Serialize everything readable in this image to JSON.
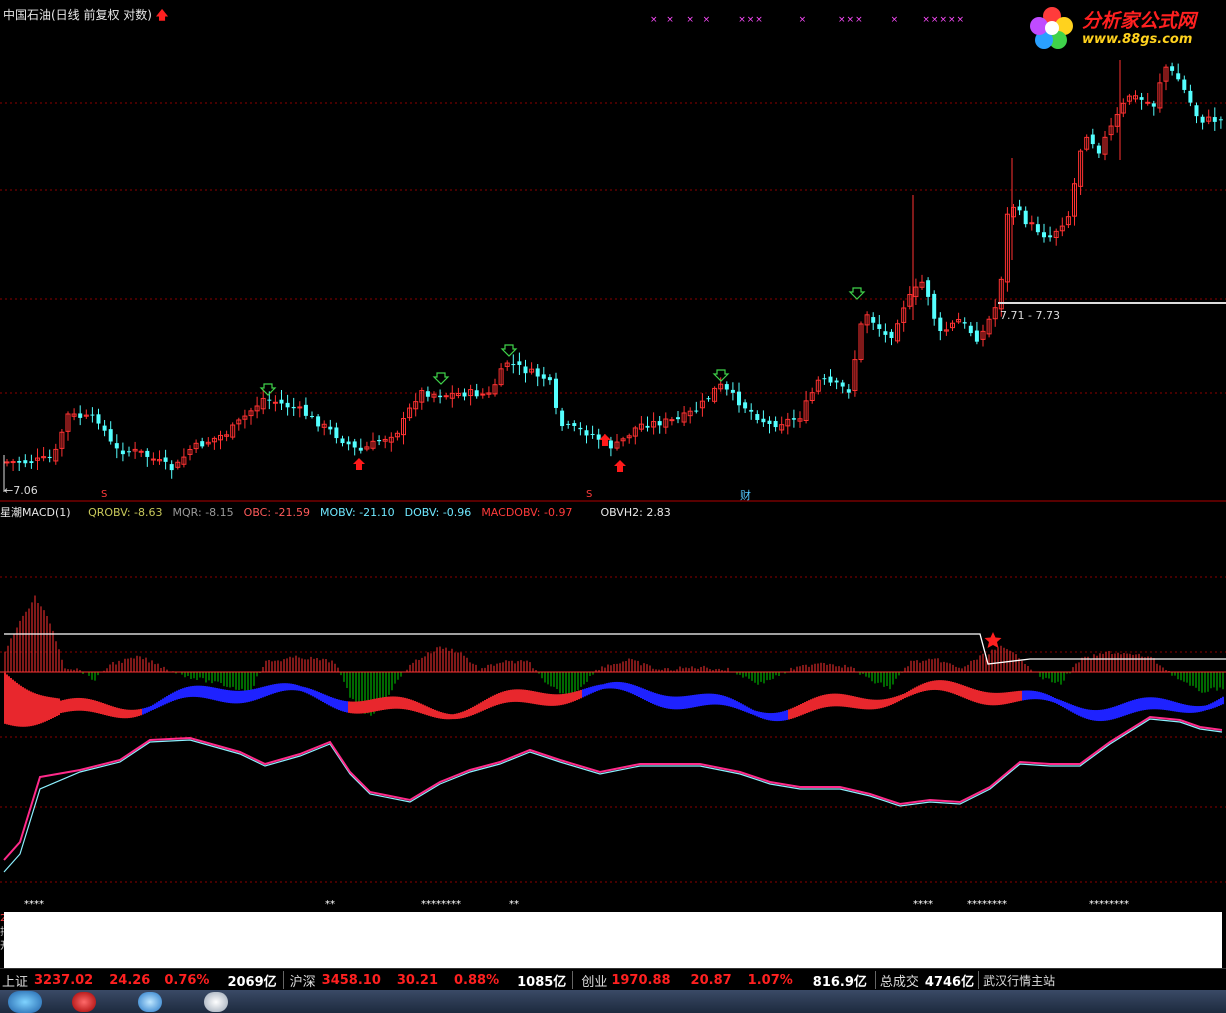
{
  "title": "中国石油(日线 前复权 对数)",
  "logo": {
    "line1": "分析家公式网",
    "line2": "www.88gs.com"
  },
  "price_labels": {
    "low": "←7.06",
    "range": "7.71 - 7.73"
  },
  "event_markers": {
    "s1": "S",
    "s2": "S",
    "cai": "财"
  },
  "pink_marks": "×  ×   ×  ×       ×××         ×        ×××       ×      ×××××",
  "indicator": {
    "name": "星潮MACD(1)",
    "items": [
      {
        "label": "QROBV:",
        "value": "-8.63",
        "color": "#c8c85a"
      },
      {
        "label": "MQR:",
        "value": "-8.15",
        "color": "#9a9a9a"
      },
      {
        "label": "OBC:",
        "value": "-21.59",
        "color": "#ff5a5a"
      },
      {
        "label": "MOBV:",
        "value": "-21.10",
        "color": "#6fe8ff"
      },
      {
        "label": "DOBV:",
        "value": "-0.96",
        "color": "#6fe8ff"
      },
      {
        "label": "MACDOBV:",
        "value": "-0.97",
        "color": "#ff3b3b"
      },
      {
        "label": "OBVH2:",
        "value": "2.83",
        "color": "#e8e8e8"
      }
    ]
  },
  "bottom_stars": {
    "g1": "****",
    "g2": "**",
    "g3": "********",
    "g4": "**",
    "g5": "****",
    "g6": "********",
    "g7": "********"
  },
  "left_marks": {
    "a": "2",
    "b": "排",
    "c": "开"
  },
  "status_bar": {
    "sh_label": "上证",
    "sh_value": "3237.02",
    "sh_change": "24.26",
    "sh_pct": "0.76%",
    "sh_amount": "2069亿",
    "hs_label": "沪深",
    "hs_value": "3458.10",
    "hs_change": "30.21",
    "hs_pct": "0.88%",
    "hs_amount": "1085亿",
    "cy_label": "创业",
    "cy_value": "1970.88",
    "cy_change": "20.87",
    "cy_pct": "1.07%",
    "cy_amount": "816.9亿",
    "total_label": "总成交",
    "total_amount": "4746亿",
    "source": "武汉行情主站"
  },
  "colors": {
    "up": "#ff3232",
    "down": "#54ffff",
    "grid": "#8c0000",
    "macd_pos": "#ff3232",
    "macd_neg": "#00d200",
    "ribbon_pos": "#e8272d",
    "ribbon_neg": "#1e22ff",
    "line_pink": "#ff2a8a",
    "line_cyan": "#8cf0ff",
    "status_red": "#ff2020"
  }
}
